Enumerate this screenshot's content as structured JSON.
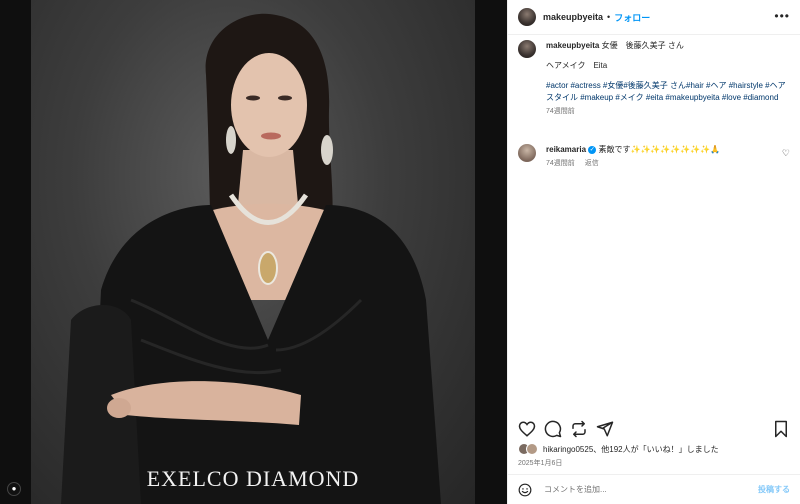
{
  "photo": {
    "brand_text": "EXELCO DIAMOND"
  },
  "header": {
    "username": "makeupbyeita",
    "separator": "•",
    "follow_label": "フォロー",
    "more_icon": "more-horizontal-icon"
  },
  "caption": {
    "username": "makeupbyeita",
    "line1": "女優　後藤久美子 さん",
    "line2": "ヘアメイク　Eita",
    "hashtags": "#actor #actress #女優#後藤久美子 さん#hair #ヘア #hairstyle #ヘアスタイル #makeup #メイク #eita #makeupbyeita #love #diamond",
    "time": "74週間前"
  },
  "comment": {
    "username": "reikamaria",
    "text": "素敵です✨✨✨✨✨✨✨✨🙏",
    "time": "74週間前",
    "reply_label": "返信"
  },
  "likes": {
    "text": "hikaringo0525、他192人が「いいね！」しました"
  },
  "date": "2025年1月6日",
  "comment_box": {
    "placeholder": "コメントを追加...",
    "post_label": "投稿する"
  }
}
